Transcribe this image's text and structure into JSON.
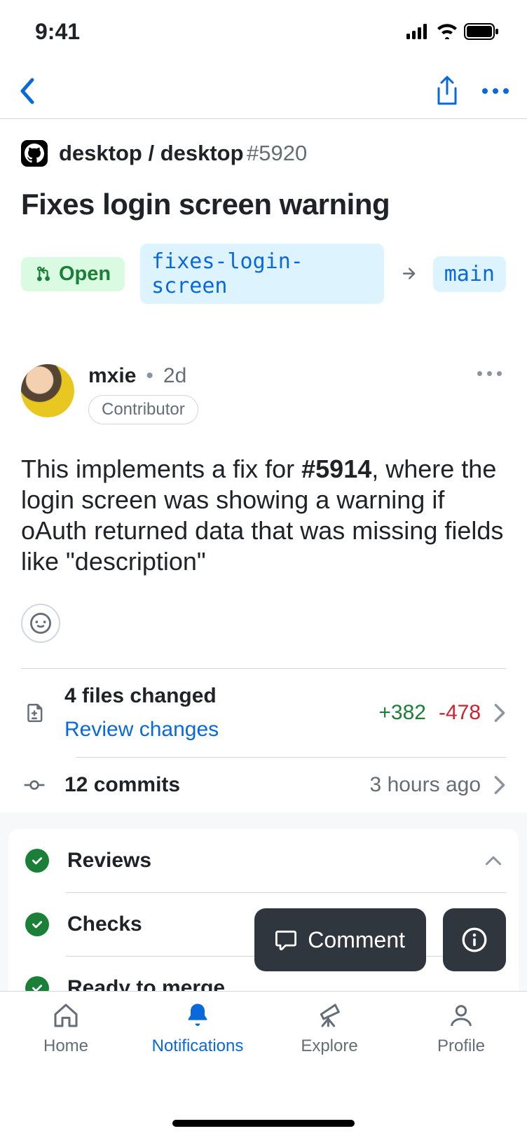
{
  "status": {
    "time": "9:41"
  },
  "repo": {
    "org": "desktop",
    "name": "desktop",
    "issue_number": "#5920"
  },
  "pr": {
    "title": "Fixes login screen warning",
    "state": "Open",
    "source_branch": "fixes-login-screen",
    "target_branch": "main"
  },
  "author": {
    "username": "mxie",
    "relative_time": "2d",
    "role": "Contributor"
  },
  "body": {
    "prefix": "This implements a fix for ",
    "issue_ref": "#5914",
    "suffix": ", where the login screen was showing a warning if oAuth returned data that was missing fields like \"description\""
  },
  "files": {
    "summary": "4 files changed",
    "action": "Review changes",
    "additions": "+382",
    "deletions": "-478"
  },
  "commits": {
    "summary": "12 commits",
    "relative_time": "3 hours ago"
  },
  "panel": {
    "reviews": "Reviews",
    "checks": "Checks",
    "merge": "Ready to merge"
  },
  "floater": {
    "comment": "Comment"
  },
  "tabs": {
    "home": "Home",
    "notifications": "Notifications",
    "explore": "Explore",
    "profile": "Profile"
  }
}
